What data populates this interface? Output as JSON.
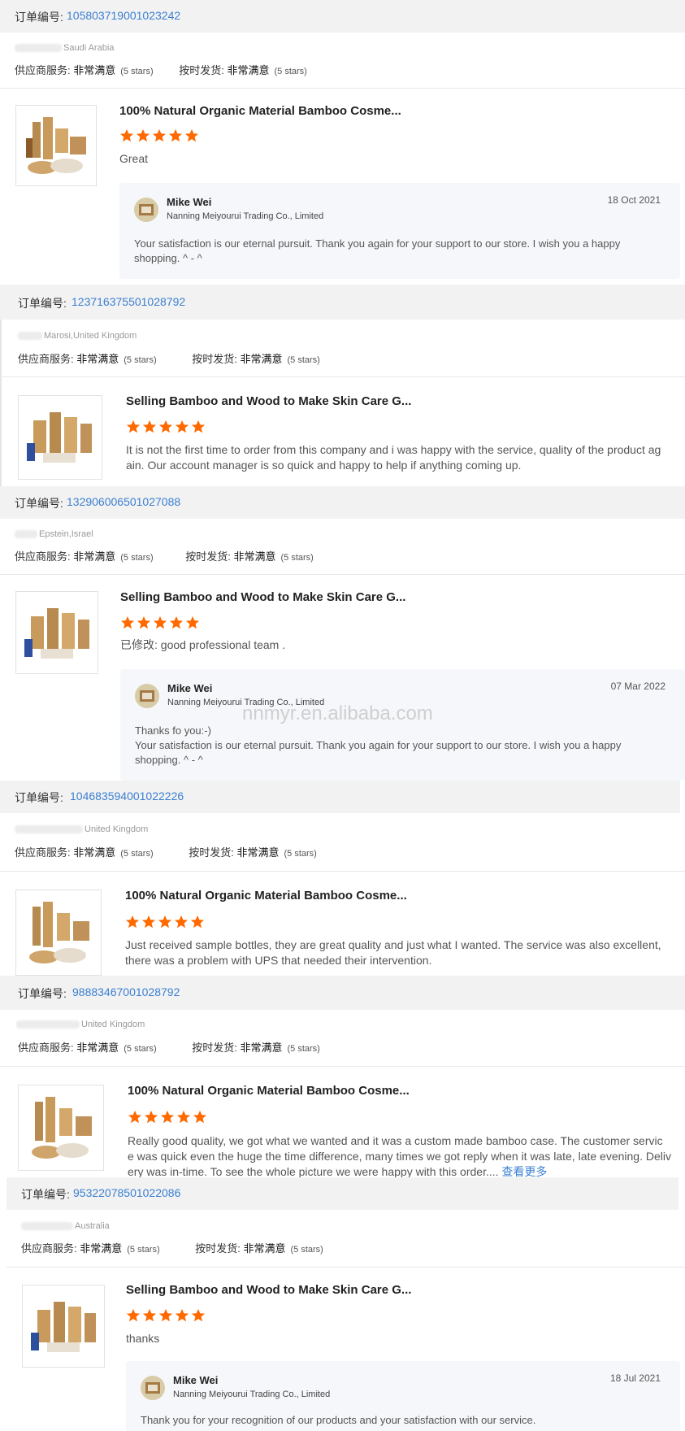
{
  "order_label": "订单编号:",
  "service_label": "供应商服务:",
  "ship_label": "按时发货:",
  "rating_word": "非常满意",
  "stars_text": "(5 stars)",
  "star_color": "#ff6a00",
  "link_color": "#3b7fd1",
  "watermark": "nnmyr.en.alibaba.com",
  "orders": [
    {
      "number": "105803719001023242",
      "location": "Saudi Arabia",
      "product_title": "100% Natural Organic Material Bamboo Cosme...",
      "review": "Great",
      "reply": {
        "name": "Mike Wei",
        "company": "Nanning Meiyourui Trading Co., Limited",
        "date": "18 Oct 2021",
        "line1": "Your satisfaction is our eternal pursuit. Thank you again for your support to our store. I wish you a happy",
        "line2": "shopping.  ^ - ^"
      }
    },
    {
      "number": "123716375501028792",
      "location": "Marosi,United Kingdom",
      "product_title": "Selling Bamboo and Wood to Make Skin Care G...",
      "review_line1": "It is not the first time to order from this company and i was happy with the service, quality of the product ag",
      "review_line2": "ain. Our account manager is so quick and happy to help if anything coming up."
    },
    {
      "number": "132906006501027088",
      "location": "Epstein,Israel",
      "product_title": "Selling Bamboo and Wood to Make Skin Care G...",
      "review": "已修改: good professional team .",
      "reply": {
        "name": "Mike Wei",
        "company": "Nanning Meiyourui Trading Co., Limited",
        "date": "07 Mar 2022",
        "line0": "Thanks fo you:-)",
        "line1": "Your satisfaction is our eternal pursuit. Thank you again for your support to our store. I wish you a happy",
        "line2": "shopping.  ^ - ^"
      }
    },
    {
      "number": "104683594001022226",
      "location": "United Kingdom",
      "product_title": "100% Natural Organic Material Bamboo Cosme...",
      "review_line1": "Just received sample bottles, they are great quality and just what I wanted. The service was also excellent,",
      "review_line2": "there was a problem with UPS that needed their intervention."
    },
    {
      "number": "98883467001028792",
      "location": "United Kingdom",
      "product_title": "100% Natural Organic Material Bamboo Cosme...",
      "review_line1": "Really good quality, we got what we wanted and it was a custom made bamboo case. The customer servic",
      "review_line2": "e was quick even the huge the time difference, many times we got reply when it was late, late evening. Deliv",
      "review_line3": "ery was in-time. To see the whole picture we were happy with this order....",
      "more_label": "查看更多"
    },
    {
      "number": "95322078501022086",
      "location": "Australia",
      "product_title": "Selling Bamboo and Wood to Make Skin Care G...",
      "review": "thanks",
      "reply": {
        "name": "Mike Wei",
        "company": "Nanning Meiyourui Trading Co., Limited",
        "date": "18 Jul 2021",
        "line1": "Thank you for your recognition of our products and your satisfaction with our service."
      }
    }
  ]
}
